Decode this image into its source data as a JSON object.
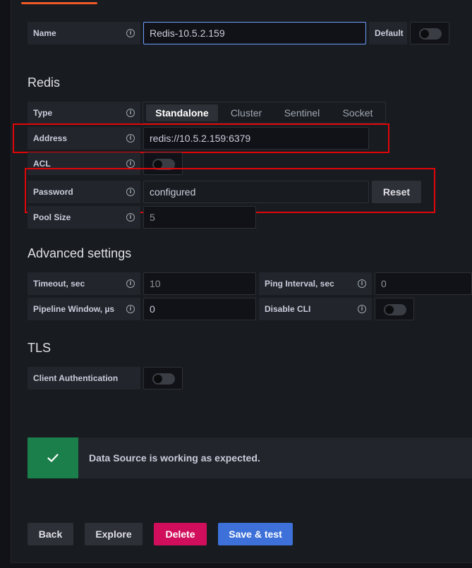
{
  "name_field": {
    "label": "Name",
    "value": "Redis-10.5.2.159",
    "default_label": "Default"
  },
  "redis": {
    "heading": "Redis",
    "type_label": "Type",
    "type_options": [
      "Standalone",
      "Cluster",
      "Sentinel",
      "Socket"
    ],
    "type_selected": "Standalone",
    "address_label": "Address",
    "address_value": "redis://10.5.2.159:6379",
    "acl_label": "ACL",
    "password_label": "Password",
    "password_value": "configured",
    "reset_label": "Reset",
    "pool_size_label": "Pool Size",
    "pool_size_placeholder": "5"
  },
  "advanced": {
    "heading": "Advanced settings",
    "timeout_label": "Timeout, sec",
    "timeout_placeholder": "10",
    "ping_label": "Ping Interval, sec",
    "ping_placeholder": "0",
    "pipeline_label": "Pipeline Window, µs",
    "pipeline_value": "0",
    "disable_cli_label": "Disable CLI"
  },
  "tls": {
    "heading": "TLS",
    "client_auth_label": "Client Authentication"
  },
  "alert": {
    "message": "Data Source is working as expected."
  },
  "actions": {
    "back": "Back",
    "explore": "Explore",
    "delete": "Delete",
    "save_test": "Save & test"
  },
  "colors": {
    "accent": "#f05a28",
    "success": "#1a7f4b",
    "danger": "#d10e5c",
    "primary": "#3d71d9",
    "highlight": "#e0060a"
  }
}
